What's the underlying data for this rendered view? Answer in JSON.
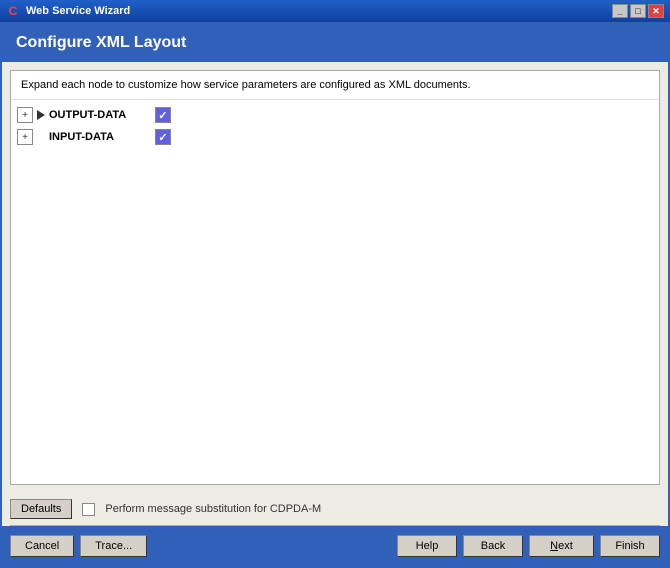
{
  "titleBar": {
    "icon": "C",
    "title": "Web Service Wizard",
    "minimize": "_",
    "maximize": "□",
    "close": "✕"
  },
  "pageTitle": "Configure XML Layout",
  "description": "Expand each node to customize how service parameters are configured as XML documents.",
  "tree": {
    "items": [
      {
        "id": "output-data",
        "label": "OUTPUT-DATA",
        "checked": true
      },
      {
        "id": "input-data",
        "label": "INPUT-DATA",
        "checked": true
      }
    ]
  },
  "bottomPanel": {
    "defaultsLabel": "Defaults",
    "checkboxLabel": "Perform message substitution for CDPDA-M"
  },
  "footer": {
    "cancelLabel": "Cancel",
    "traceLabel": "Trace...",
    "helpLabel": "Help",
    "backLabel": "Back",
    "nextLabel": "Next",
    "finishLabel": "Finish"
  }
}
